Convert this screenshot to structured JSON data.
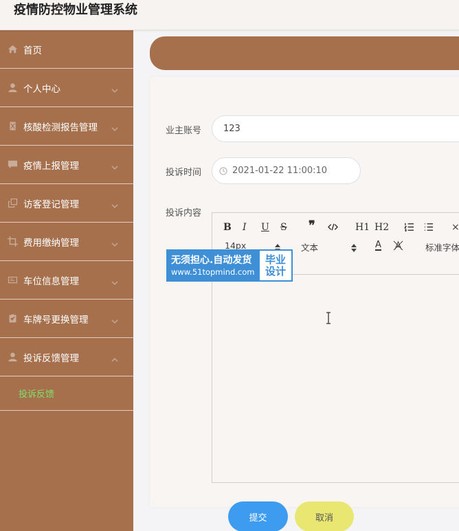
{
  "app": {
    "title": "疫情防控物业管理系统"
  },
  "sidebar": {
    "items": [
      {
        "label": "首页",
        "icon": "home-icon",
        "has_chevron": false
      },
      {
        "label": "个人中心",
        "icon": "user-icon",
        "has_chevron": true
      },
      {
        "label": "核酸检测报告管理",
        "icon": "report-icon",
        "has_chevron": true
      },
      {
        "label": "疫情上报管理",
        "icon": "chat-icon",
        "has_chevron": true
      },
      {
        "label": "访客登记管理",
        "icon": "copy-icon",
        "has_chevron": true
      },
      {
        "label": "费用缴纳管理",
        "icon": "crop-icon",
        "has_chevron": true
      },
      {
        "label": "车位信息管理",
        "icon": "card-icon",
        "has_chevron": true
      },
      {
        "label": "车牌号更换管理",
        "icon": "clipboard-icon",
        "has_chevron": true
      },
      {
        "label": "投诉反馈管理",
        "icon": "user-icon",
        "has_chevron": true,
        "expanded": true
      }
    ],
    "active_submenu": "投诉反馈"
  },
  "form": {
    "account_label": "业主账号",
    "account_value": "123",
    "time_label": "投诉时间",
    "time_value": "2021-01-22 11:00:10",
    "content_label": "投诉内容"
  },
  "editor": {
    "font_size": "14px",
    "paragraph": "文本",
    "font_family": "标准字体",
    "h1": "H1",
    "h2": "H2"
  },
  "buttons": {
    "submit": "提交",
    "cancel": "取消"
  },
  "watermark": {
    "line1": "无须担心.自动发货",
    "line2": "www.51topmind.com",
    "right_top": "毕业",
    "right_bottom": "设计"
  },
  "colors": {
    "sidebar_bg": "#a6704d",
    "active_submenu": "#7ee06a",
    "submit_bg": "#3d9cf0",
    "cancel_bg": "#e9e772",
    "watermark_blue": "#3e8fd6"
  }
}
